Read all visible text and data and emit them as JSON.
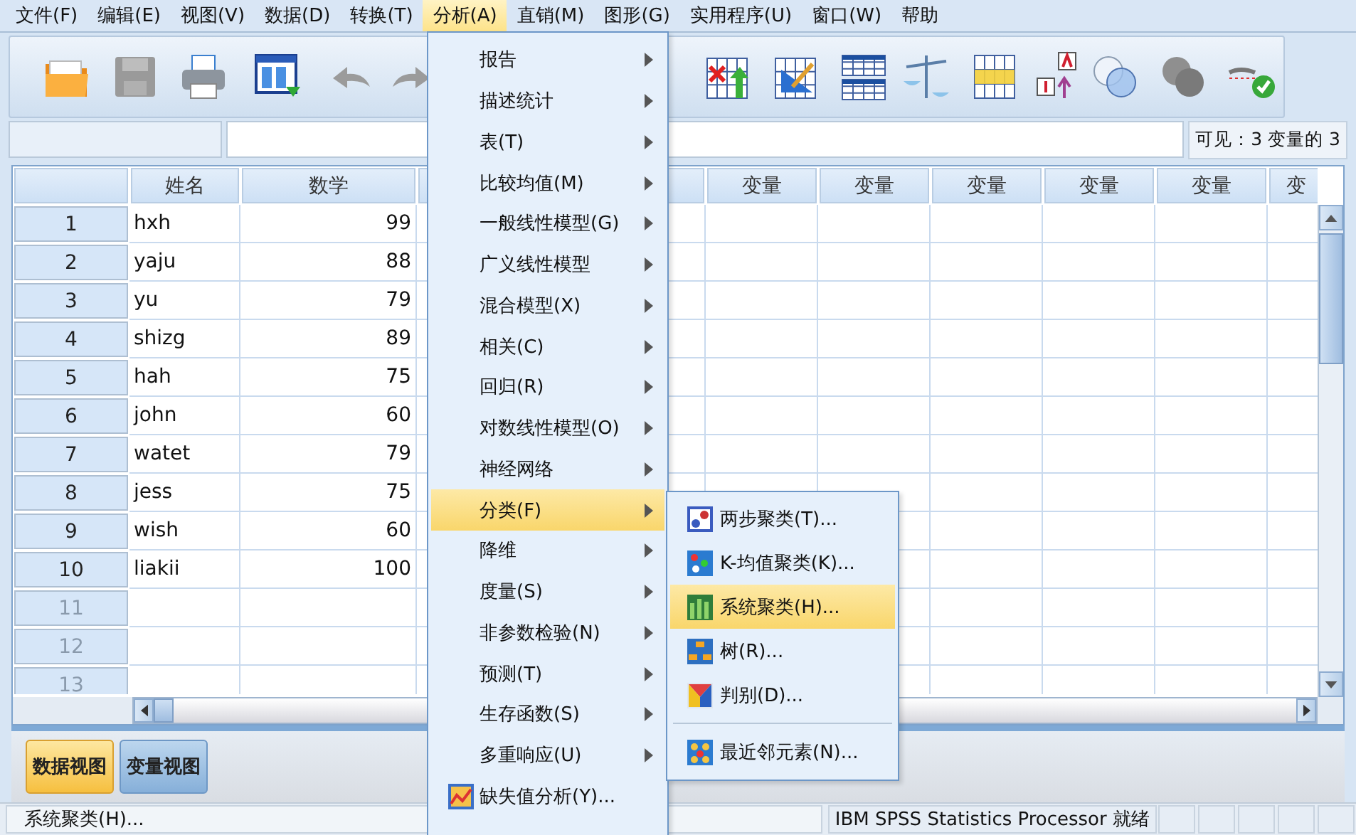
{
  "menubar": [
    {
      "label": "文件(F)",
      "selected": false
    },
    {
      "label": "编辑(E)",
      "selected": false
    },
    {
      "label": "视图(V)",
      "selected": false
    },
    {
      "label": "数据(D)",
      "selected": false
    },
    {
      "label": "转换(T)",
      "selected": false
    },
    {
      "label": "分析(A)",
      "selected": true
    },
    {
      "label": "直销(M)",
      "selected": false
    },
    {
      "label": "图形(G)",
      "selected": false
    },
    {
      "label": "实用程序(U)",
      "selected": false
    },
    {
      "label": "窗口(W)",
      "selected": false
    },
    {
      "label": "帮助",
      "selected": false
    }
  ],
  "visible_info": "可见：3 变量的 3",
  "grid": {
    "columns": [
      "姓名",
      "数学",
      "变量",
      "变量",
      "变量",
      "变量",
      "变量",
      "变"
    ],
    "rows": [
      {
        "number": "1",
        "cells": [
          "hxh",
          "99"
        ]
      },
      {
        "number": "2",
        "cells": [
          "yaju",
          "88"
        ]
      },
      {
        "number": "3",
        "cells": [
          "yu",
          "79"
        ]
      },
      {
        "number": "4",
        "cells": [
          "shizg",
          "89"
        ]
      },
      {
        "number": "5",
        "cells": [
          "hah",
          "75"
        ]
      },
      {
        "number": "6",
        "cells": [
          "john",
          "60"
        ]
      },
      {
        "number": "7",
        "cells": [
          "watet",
          "79"
        ]
      },
      {
        "number": "8",
        "cells": [
          "jess",
          "75"
        ]
      },
      {
        "number": "9",
        "cells": [
          "wish",
          "60"
        ]
      },
      {
        "number": "10",
        "cells": [
          "liakii",
          "100"
        ]
      },
      {
        "number": "11",
        "cells": []
      },
      {
        "number": "12",
        "cells": []
      },
      {
        "number": "13",
        "cells": []
      }
    ]
  },
  "view_tabs": [
    {
      "label": "数据视图",
      "selected": true
    },
    {
      "label": "变量视图",
      "selected": false
    }
  ],
  "status_bar": {
    "message": "系统聚类(H)...",
    "processor": "IBM SPSS Statistics Processor 就绪"
  },
  "analyze_menu": [
    {
      "label": "报告",
      "kind": "submenu",
      "selected": false
    },
    {
      "label": "描述统计",
      "kind": "submenu",
      "selected": false
    },
    {
      "label": "表(T)",
      "kind": "submenu",
      "selected": false
    },
    {
      "label": "比较均值(M)",
      "kind": "submenu",
      "selected": false
    },
    {
      "label": "一般线性模型(G)",
      "kind": "submenu",
      "selected": false
    },
    {
      "label": "广义线性模型",
      "kind": "submenu",
      "selected": false
    },
    {
      "label": "混合模型(X)",
      "kind": "submenu",
      "selected": false
    },
    {
      "label": "相关(C)",
      "kind": "submenu",
      "selected": false
    },
    {
      "label": "回归(R)",
      "kind": "submenu",
      "selected": false
    },
    {
      "label": "对数线性模型(O)",
      "kind": "submenu",
      "selected": false
    },
    {
      "label": "神经网络",
      "kind": "submenu",
      "selected": false
    },
    {
      "label": "分类(F)",
      "kind": "submenu",
      "selected": true
    },
    {
      "label": "降维",
      "kind": "submenu",
      "selected": false
    },
    {
      "label": "度量(S)",
      "kind": "submenu",
      "selected": false
    },
    {
      "label": "非参数检验(N)",
      "kind": "submenu",
      "selected": false
    },
    {
      "label": "预测(T)",
      "kind": "submenu",
      "selected": false
    },
    {
      "label": "生存函数(S)",
      "kind": "submenu",
      "selected": false
    },
    {
      "label": "多重响应(U)",
      "kind": "submenu",
      "selected": false
    },
    {
      "label": "缺失值分析(Y)...",
      "kind": "command",
      "selected": false
    }
  ],
  "classify_submenu": [
    {
      "label": "两步聚类(T)...",
      "kind": "item",
      "selected": false
    },
    {
      "label": "K-均值聚类(K)...",
      "kind": "item",
      "selected": false
    },
    {
      "label": "系统聚类(H)...",
      "kind": "item",
      "selected": true
    },
    {
      "label": "树(R)...",
      "kind": "item",
      "selected": false
    },
    {
      "label": "判别(D)...",
      "kind": "item",
      "selected": false
    },
    {
      "kind": "separator"
    },
    {
      "label": "最近邻元素(N)...",
      "kind": "item",
      "selected": false
    }
  ]
}
